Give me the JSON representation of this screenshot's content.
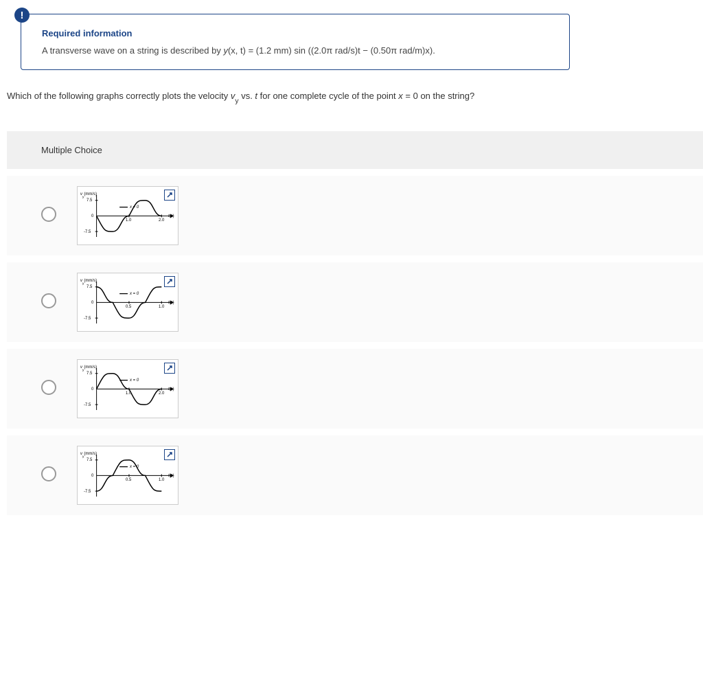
{
  "info": {
    "title": "Required information",
    "text_prefix": "A transverse wave on a string is described by ",
    "equation_y": "y",
    "equation_args": "(x, t) = (1.2 mm) sin ((2.0π rad/s)t − (0.50π rad/m)x).",
    "badge": "!"
  },
  "question": {
    "prefix": "Which of the following graphs correctly plots the velocity ",
    "v": "v",
    "sub": "y",
    "mid": " vs. ",
    "tvar": "t",
    "suffix": " for one complete cycle of the point ",
    "xvar": "x",
    "eq": " = 0 on the string?"
  },
  "mc_label": "Multiple Choice",
  "graphs": {
    "ylabel": "v",
    "ylabel_sub": "y",
    "ylabel_unit": "(mm/s)",
    "ymax": "7.5",
    "yzero": "0",
    "ymin": "-7.5",
    "legend": "x = 0",
    "xlabel_t": "t",
    "xlabel_unit": "(s)"
  },
  "option_a": {
    "tick1": "1.0",
    "tick2": "2.0"
  },
  "option_b": {
    "tick1": "0.5",
    "tick2": "1.0"
  },
  "option_c": {
    "tick1": "1.0",
    "tick2": "2.0"
  },
  "option_d": {
    "tick1": "0.5",
    "tick2": "1.0"
  },
  "chart_data": [
    {
      "type": "line",
      "option": "A",
      "shape": "-sin",
      "xrange": [
        0,
        2.0
      ],
      "yrange": [
        -7.5,
        7.5
      ],
      "xlabel": "t (s)",
      "ylabel": "vy (mm/s)",
      "legend": "x = 0",
      "period": 2.0
    },
    {
      "type": "line",
      "option": "B",
      "shape": "cos",
      "xrange": [
        0,
        1.0
      ],
      "yrange": [
        -7.5,
        7.5
      ],
      "xlabel": "t (s)",
      "ylabel": "vy (mm/s)",
      "legend": "x = 0",
      "period": 1.0
    },
    {
      "type": "line",
      "option": "C",
      "shape": "sin",
      "xrange": [
        0,
        2.0
      ],
      "yrange": [
        -7.5,
        7.5
      ],
      "xlabel": "t (s)",
      "ylabel": "vy (mm/s)",
      "legend": "x = 0",
      "period": 2.0
    },
    {
      "type": "line",
      "option": "D",
      "shape": "-cos",
      "xrange": [
        0,
        1.0
      ],
      "yrange": [
        -7.5,
        7.5
      ],
      "xlabel": "t (s)",
      "ylabel": "vy (mm/s)",
      "legend": "x = 0",
      "period": 1.0
    }
  ]
}
